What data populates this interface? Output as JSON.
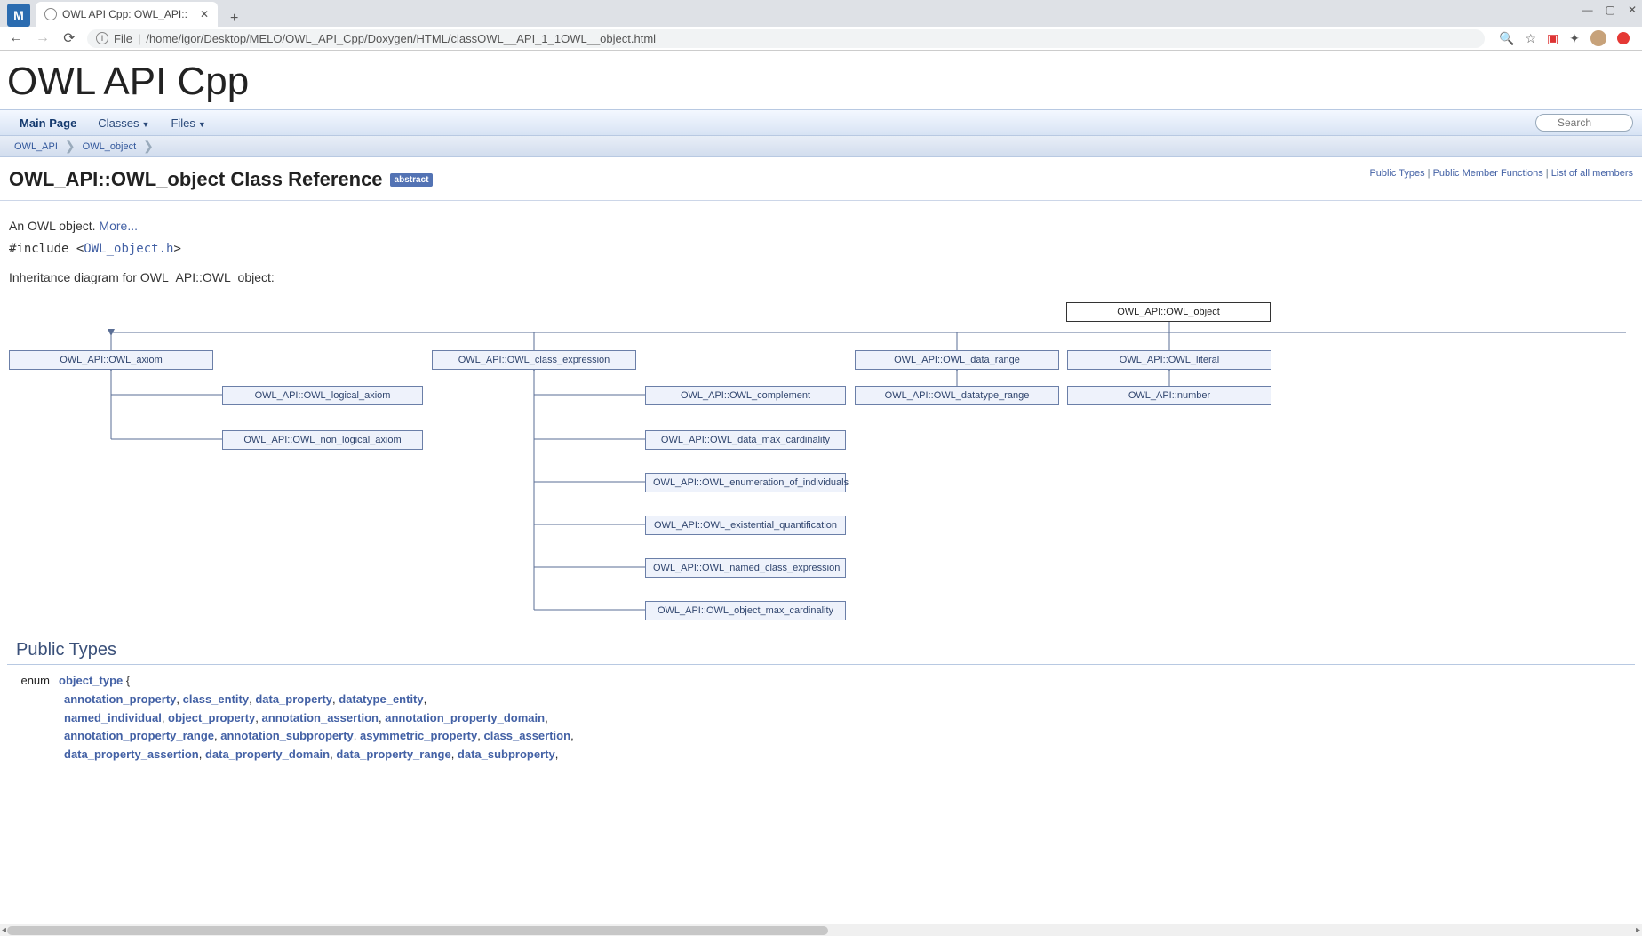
{
  "browser": {
    "tab_title": "OWL API Cpp: OWL_API::",
    "url_prefix": "File",
    "url_path": "/home/igor/Desktop/MELO/OWL_API_Cpp/Doxygen/HTML/classOWL__API_1_1OWL__object.html",
    "win_min": "—",
    "win_max": "▢",
    "win_close": "✕"
  },
  "project_title": "OWL API Cpp",
  "nav": {
    "main_page": "Main Page",
    "classes": "Classes",
    "files": "Files",
    "search_placeholder": "Search"
  },
  "breadcrumb": {
    "root": "OWL_API",
    "leaf": "OWL_object"
  },
  "page": {
    "title": "OWL_API::OWL_object Class Reference",
    "abstract_badge": "abstract",
    "quick_links": {
      "public_types": "Public Types",
      "public_members": "Public Member Functions",
      "all_members": "List of all members"
    },
    "brief": "An OWL object.",
    "more": "More...",
    "include_pre": "#include <",
    "include_file": "OWL_object.h",
    "include_post": ">",
    "inherit_label": "Inheritance diagram for OWL_API::OWL_object:"
  },
  "diagram": {
    "root": "OWL_API::OWL_object",
    "row1": {
      "axiom": "OWL_API::OWL_axiom",
      "class_expr": "OWL_API::OWL_class_expression",
      "data_range": "OWL_API::OWL_data_range",
      "literal": "OWL_API::OWL_literal"
    },
    "axiom_children": {
      "logical": "OWL_API::OWL_logical_axiom",
      "non_logical": "OWL_API::OWL_non_logical_axiom"
    },
    "class_expr_children": {
      "complement": "OWL_API::OWL_complement",
      "data_max_card": "OWL_API::OWL_data_max_cardinality",
      "enum_ind": "OWL_API::OWL_enumeration_of_individuals",
      "exist_quant": "OWL_API::OWL_existential_quantification",
      "named_ce": "OWL_API::OWL_named_class_expression",
      "obj_max_card": "OWL_API::OWL_object_max_cardinality"
    },
    "data_range_children": {
      "datatype_range": "OWL_API::OWL_datatype_range"
    },
    "literal_children": {
      "number": "OWL_API::number"
    }
  },
  "public_types_header": "Public Types",
  "enum": {
    "keyword": "enum",
    "name": "object_type",
    "brace": "{",
    "line1": [
      "annotation_property",
      "class_entity",
      "data_property",
      "datatype_entity"
    ],
    "line2": [
      "named_individual",
      "object_property",
      "annotation_assertion",
      "annotation_property_domain"
    ],
    "line3": [
      "annotation_property_range",
      "annotation_subproperty",
      "asymmetric_property",
      "class_assertion"
    ],
    "line4": [
      "data_property_assertion",
      "data_property_domain",
      "data_property_range",
      "data_subproperty"
    ]
  }
}
